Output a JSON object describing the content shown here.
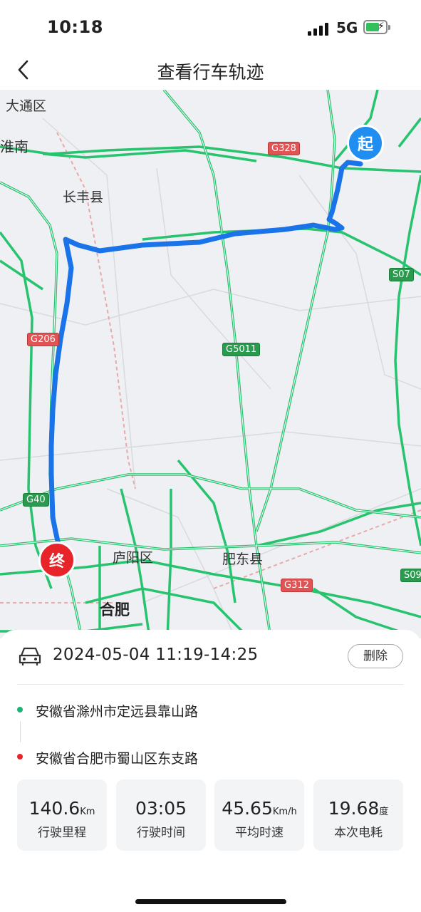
{
  "status": {
    "time": "10:18",
    "network": "5G"
  },
  "nav": {
    "title": "查看行车轨迹"
  },
  "map": {
    "places": [
      "大通区",
      "淮南",
      "长丰县",
      "庐阳区",
      "肥东县",
      "合肥"
    ],
    "highways": [
      "G328",
      "G206",
      "G5011",
      "S07",
      "G40",
      "G312",
      "S09"
    ],
    "markers": {
      "start": "起",
      "end": "终"
    },
    "colors": {
      "route": "#1a73e8",
      "road": "#27c36e",
      "background": "#eef0f3"
    }
  },
  "trip": {
    "date_range": "2024-05-04 11:19-14:25",
    "delete_label": "删除",
    "start_address": "安徽省滁州市定远县靠山路",
    "end_address": "安徽省合肥市蜀山区东支路",
    "stats": [
      {
        "value": "140.6",
        "unit": "Km",
        "label": "行驶里程"
      },
      {
        "value": "03:05",
        "unit": "",
        "label": "行驶时间"
      },
      {
        "value": "45.65",
        "unit": "Km/h",
        "label": "平均时速"
      },
      {
        "value": "19.68",
        "unit": "度",
        "label": "本次电耗"
      }
    ]
  }
}
